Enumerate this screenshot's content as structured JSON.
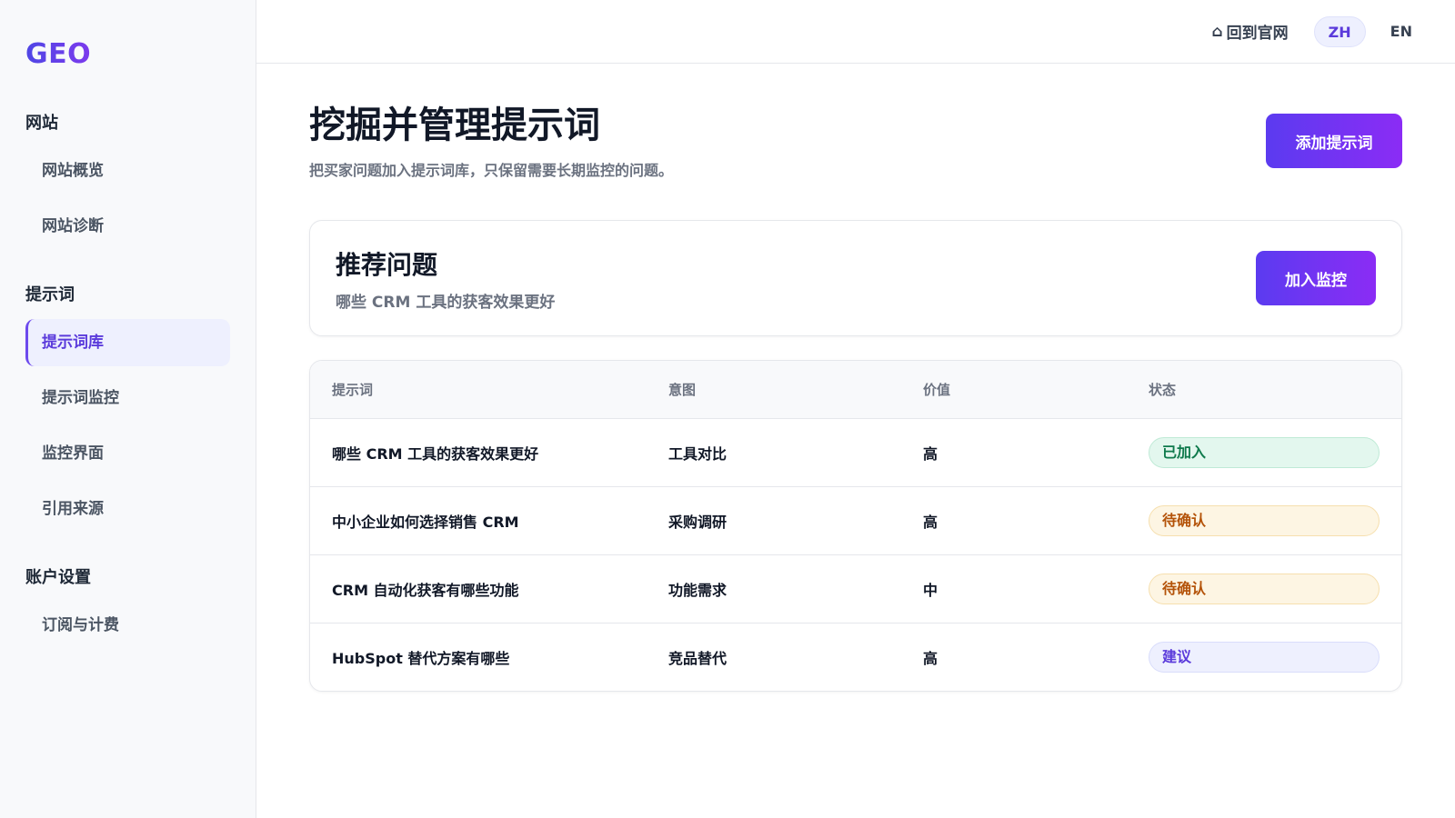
{
  "brand": {
    "logo": "GEO"
  },
  "sidebar": {
    "sections": [
      {
        "title": "网站",
        "items": [
          {
            "label": "网站概览"
          },
          {
            "label": "网站诊断"
          }
        ]
      },
      {
        "title": "提示词",
        "items": [
          {
            "label": "提示词库",
            "active": true
          },
          {
            "label": "提示词监控"
          },
          {
            "label": "监控界面"
          },
          {
            "label": "引用来源"
          }
        ]
      },
      {
        "title": "账户设置",
        "items": [
          {
            "label": "订阅与计费"
          }
        ]
      }
    ]
  },
  "topbar": {
    "home_icon": "⌂",
    "home_label": "回到官网",
    "lang_zh": "ZH",
    "lang_en": "EN",
    "active_lang": "ZH"
  },
  "page": {
    "title": "挖掘并管理提示词",
    "subtitle": "把买家问题加入提示词库，只保留需要长期监控的问题。",
    "add_button": "添加提示词"
  },
  "recommend": {
    "title": "推荐问题",
    "question": "哪些 CRM 工具的获客效果更好",
    "button": "加入监控"
  },
  "table": {
    "headers": [
      "提示词",
      "意图",
      "价值",
      "状态"
    ],
    "rows": [
      {
        "prompt": "哪些 CRM 工具的获客效果更好",
        "intent": "工具对比",
        "value": "高",
        "status": "已加入",
        "status_type": "added"
      },
      {
        "prompt": "中小企业如何选择销售 CRM",
        "intent": "采购调研",
        "value": "高",
        "status": "待确认",
        "status_type": "pending"
      },
      {
        "prompt": "CRM 自动化获客有哪些功能",
        "intent": "功能需求",
        "value": "中",
        "status": "待确认",
        "status_type": "pending"
      },
      {
        "prompt": "HubSpot 替代方案有哪些",
        "intent": "竞品替代",
        "value": "高",
        "status": "建议",
        "status_type": "suggest"
      }
    ]
  },
  "colors": {
    "accent": "#5b3bdb",
    "button_gradient_start": "#5b3bf0",
    "button_gradient_end": "#8b2cf5",
    "status_added": "#0f7a4c",
    "status_pending": "#b45309",
    "status_suggest": "#5b3bdb"
  }
}
